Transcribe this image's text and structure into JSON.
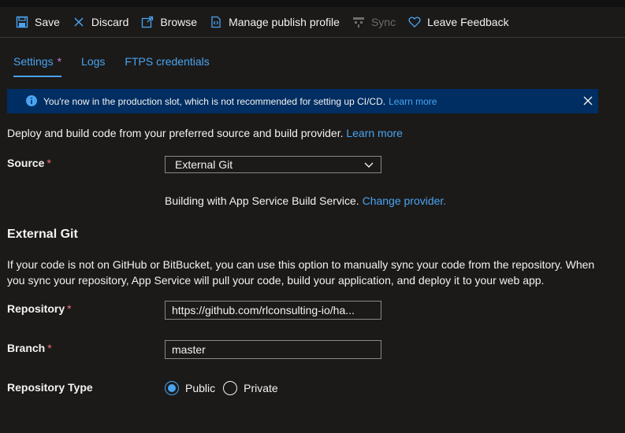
{
  "toolbar": {
    "save": "Save",
    "discard": "Discard",
    "browse": "Browse",
    "manage": "Manage publish profile",
    "sync": "Sync",
    "feedback": "Leave Feedback"
  },
  "tabs": {
    "settings": "Settings",
    "settings_marker": "*",
    "logs": "Logs",
    "ftps": "FTPS credentials"
  },
  "banner": {
    "message": "You're now in the production slot, which is not recommended for setting up CI/CD.",
    "link": "Learn more"
  },
  "description": {
    "text": "Deploy and build code from your preferred source and build provider.",
    "link": "Learn more"
  },
  "source": {
    "label": "Source",
    "required": "*",
    "value": "External Git"
  },
  "build": {
    "text": "Building with App Service Build Service.",
    "link": "Change provider."
  },
  "external_git": {
    "heading": "External Git",
    "paragraph": "If your code is not on GitHub or BitBucket, you can use this option to manually sync your code from the repository. When you sync your repository, App Service will pull your code, build your application, and deploy it to your web app."
  },
  "repository": {
    "label": "Repository",
    "required": "*",
    "value": "https://github.com/rlconsulting-io/ha..."
  },
  "branch": {
    "label": "Branch",
    "required": "*",
    "value": "master"
  },
  "repo_type": {
    "label": "Repository Type",
    "public": "Public",
    "private": "Private",
    "selected": "Public"
  },
  "colors": {
    "background": "#1b1a19",
    "accent": "#4aa3f0",
    "banner": "#002e62",
    "required": "#f1707b"
  }
}
